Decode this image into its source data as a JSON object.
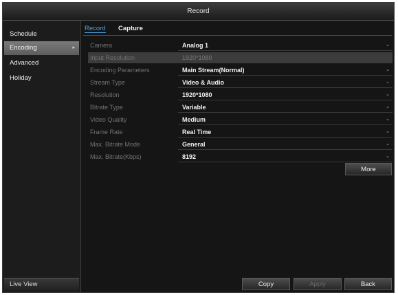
{
  "window": {
    "title": "Record"
  },
  "sidebar": {
    "items": [
      {
        "label": "Schedule"
      },
      {
        "label": "Encoding",
        "arrow": "▸"
      },
      {
        "label": "Advanced"
      },
      {
        "label": "Holiday"
      }
    ],
    "live_view": "Live View"
  },
  "tabs": [
    {
      "label": "Record"
    },
    {
      "label": "Capture"
    }
  ],
  "form": {
    "rows": [
      {
        "label": "Camera",
        "value": "Analog 1"
      },
      {
        "label": "Input Resolution",
        "value": "1920*1080"
      },
      {
        "label": "Encoding Parameters",
        "value": "Main Stream(Normal)"
      },
      {
        "label": "Stream Type",
        "value": "Video & Audio"
      },
      {
        "label": "Resolution",
        "value": "1920*1080"
      },
      {
        "label": "Bitrate Type",
        "value": "Variable"
      },
      {
        "label": "Video Quality",
        "value": "Medium"
      },
      {
        "label": "Frame Rate",
        "value": "Real Time"
      },
      {
        "label": "Max. Bitrate Mode",
        "value": "General"
      },
      {
        "label": "Max. Bitrate(Kbps)",
        "value": "8192"
      }
    ],
    "dropdown_chevron": "⌄"
  },
  "buttons": {
    "more": "More",
    "copy": "Copy",
    "apply": "Apply",
    "back": "Back"
  }
}
